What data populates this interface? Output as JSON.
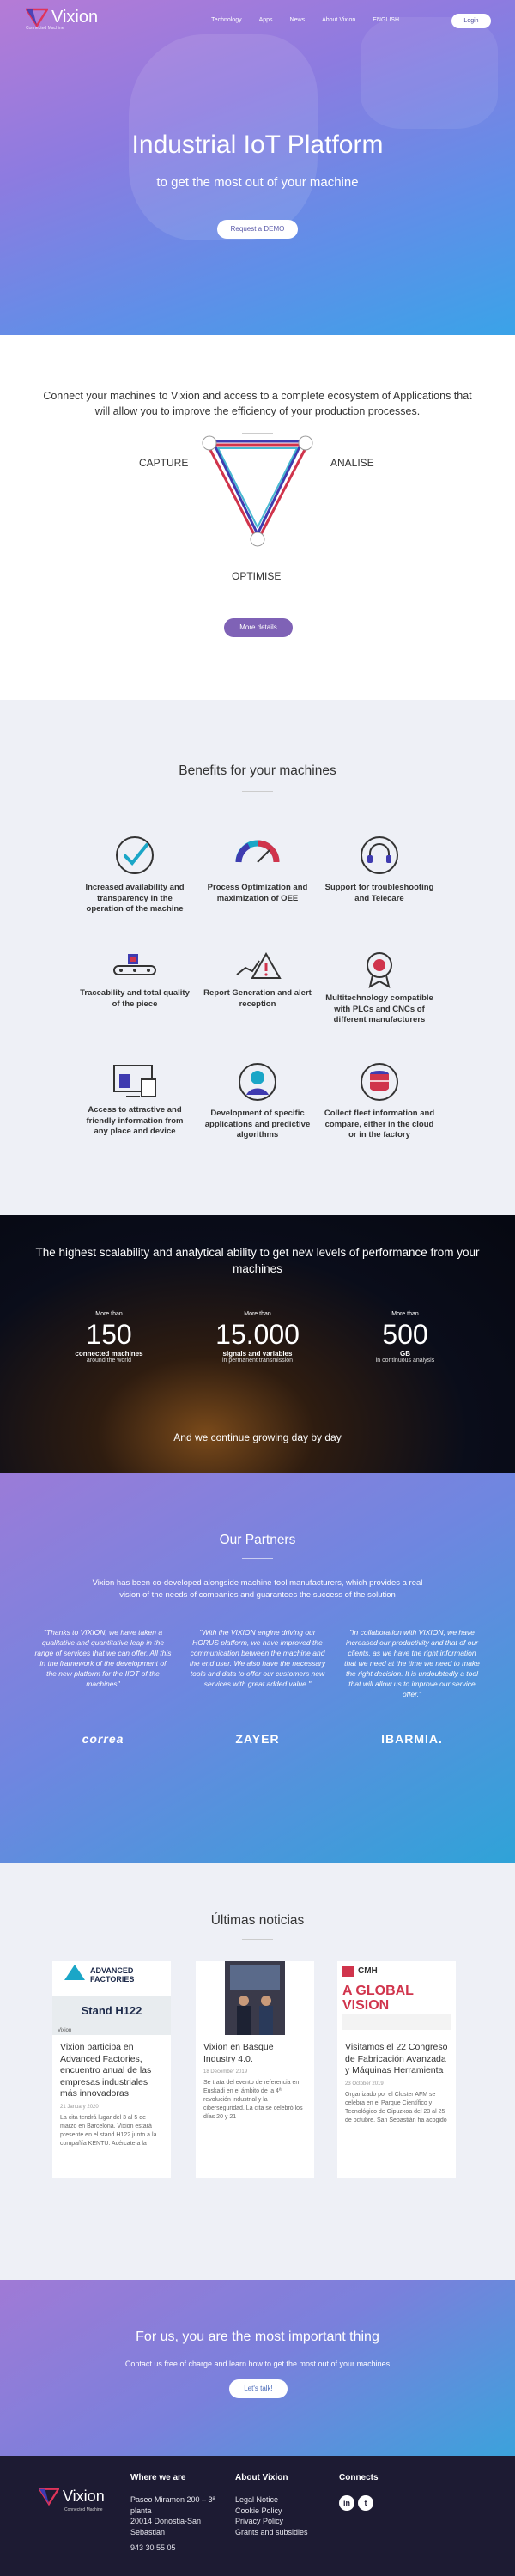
{
  "nav": {
    "brand": "Vixion",
    "tagline": "Connected Machine",
    "items": [
      "Technology",
      "Apps",
      "News",
      "About Vixion",
      "ENGLISH"
    ],
    "login": "Login"
  },
  "hero": {
    "title": "Industrial IoT Platform",
    "subtitle": "to get the most out of your machine",
    "cta": "Request a DEMO"
  },
  "connect": {
    "text": "Connect your machines to Vixion and access to a complete ecosystem of Applications that will allow you to improve the efficiency of your production processes.",
    "labels": {
      "capture": "CAPTURE",
      "analise": "ANALISE",
      "optimise": "OPTIMISE"
    },
    "button": "More details",
    "colors": {
      "red": "#d0344c",
      "blue": "#3f3bb0",
      "teal": "#1aa6c7"
    }
  },
  "benefits": {
    "title": "Benefits for your machines",
    "items": [
      {
        "icon": "check-cycle-icon",
        "text": "Increased availability and transparency in the operation of the machine"
      },
      {
        "icon": "gauge-icon",
        "text": "Process Optimization and maximization of OEE"
      },
      {
        "icon": "headset-icon",
        "text": "Support for troubleshooting and Telecare"
      },
      {
        "icon": "conveyor-icon",
        "text": "Traceability and total quality of the piece"
      },
      {
        "icon": "warning-chart-icon",
        "text": "Report Generation and alert reception"
      },
      {
        "icon": "badge-icon",
        "text": "Multitechnology compatible with PLCs and CNCs of different manufacturers"
      },
      {
        "icon": "devices-icon",
        "text": "Access to attractive and friendly information from any place and device"
      },
      {
        "icon": "developer-icon",
        "text": "Development of specific applications and predictive algorithms"
      },
      {
        "icon": "cloud-database-icon",
        "text": "Collect fleet information and compare, either in the cloud or in the factory"
      }
    ]
  },
  "scale": {
    "title": "The highest scalability and analytical ability to get new levels of performance from your machines",
    "stats": [
      {
        "pre": "More than",
        "number": "150",
        "unit": "connected machines",
        "sub": "around the world"
      },
      {
        "pre": "More than",
        "number": "15.000",
        "unit": "signals and variables",
        "sub": "in permanent transmission"
      },
      {
        "pre": "More than",
        "number": "500",
        "unit": "GB",
        "sub": "in continuous analysis"
      }
    ],
    "footer": "And we continue growing day by day"
  },
  "partners": {
    "title": "Our Partners",
    "intro": "Vixion has been co-developed alongside machine tool manufacturers, which provides a real vision of the needs of companies and guarantees the success of the solution",
    "quotes": [
      "\"Thanks to VIXION, we have taken a qualitative and quantitative leap in the range of services that we can offer. All this in the framework of the development of the new platform for the IIOT of the machines\"",
      "\"With the VIXION engine driving our HORUS platform, we have improved the communication between the machine and the end user. We also have the necessary tools and data to offer our customers new services with great added value.\"",
      "\"In collaboration with VIXION, we have increased our productivity and that of our clients, as we have the right information that we need at the time we need to make the right decision. It is undoubtedly a tool that will allow us to improve our service offer.\""
    ],
    "logos": [
      "correa",
      "ZAYER",
      "IBARMIA."
    ]
  },
  "news": {
    "title": "Últimas noticias",
    "cards": [
      {
        "image_headline": "ADVANCED FACTORIES",
        "image_sub": "Stand H122",
        "title": "Vixion participa en Advanced Factories, encuentro anual de las empresas industriales más innovadoras",
        "date": "21 January 2020",
        "excerpt": "La cita tendrá lugar del 3 al 5 de marzo en Barcelona. Vixion estará presente en el stand H122 junto a la compañía KENTU. Acércate a la"
      },
      {
        "image_headline": "",
        "image_sub": "",
        "title": "Vixion en Basque Industry 4.0.",
        "date": "18 December 2019",
        "excerpt": "Se trata del evento de referencia en Euskadi en el ámbito de la 4ª revolución industrial y la ciberseguridad. La cita se celebró los días 20 y 21"
      },
      {
        "image_headline": "CMH",
        "image_sub": "A GLOBAL VISION",
        "title": "Visitamos el 22 Congreso de Fabricación Avanzada y Máquinas Herramienta",
        "date": "23 October 2019",
        "excerpt": "Organizado por el Cluster AFM se celebra en el Parque Científico y Tecnológico de Gipuzkoa del 23 al 25 de octubre. San Sebastián ha acogido"
      }
    ]
  },
  "cta": {
    "title": "For us, you are the most important thing",
    "subtitle": "Contact us free of charge and learn how to get the most out of your machines",
    "button": "Let's talk!"
  },
  "footer": {
    "where_title": "Where we are",
    "address": [
      "Paseo Miramon 200 – 3ª planta",
      "20014 Donostia-San Sebastian",
      "943 30 55 05"
    ],
    "about_title": "About Vixion",
    "about_links": [
      "Legal Notice",
      "Cookie Policy",
      "Privacy Policy",
      "Grants and subsidies"
    ],
    "connect_title": "Connects"
  }
}
